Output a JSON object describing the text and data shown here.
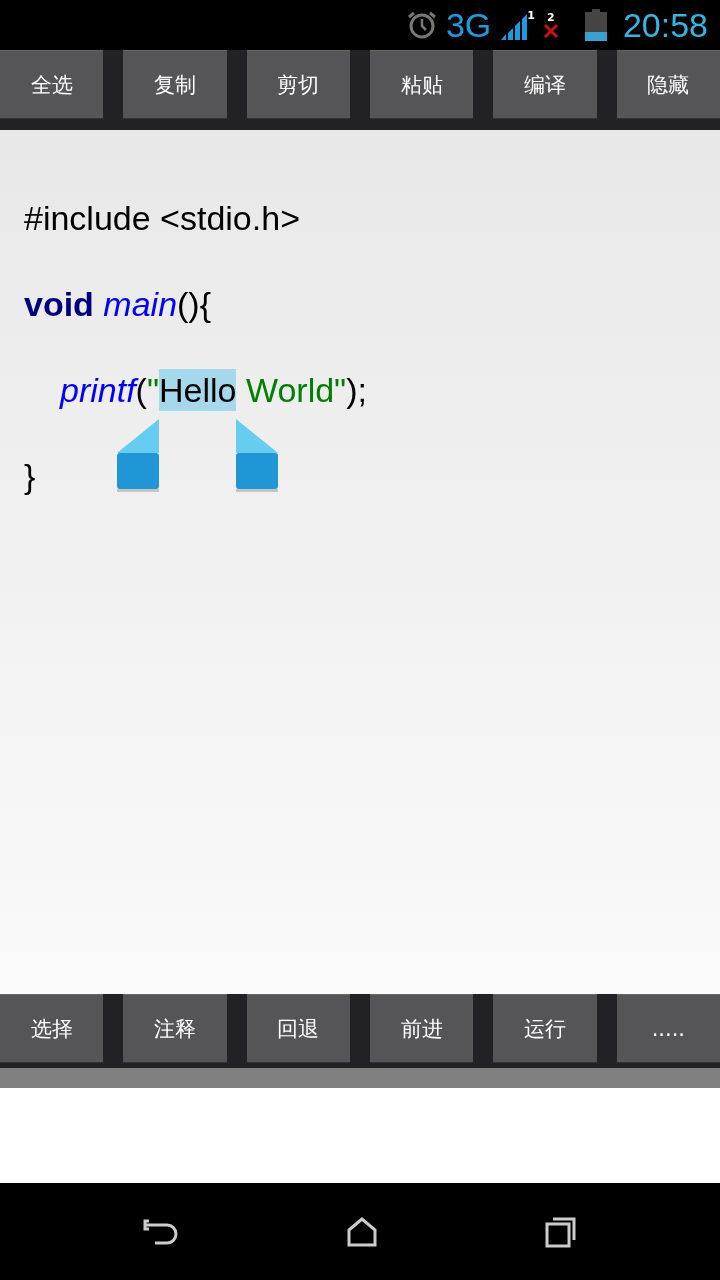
{
  "status_bar": {
    "network": "3G",
    "sim_1": "1",
    "sim_2": "2",
    "time": "20:58"
  },
  "top_toolbar": {
    "buttons": [
      "全选",
      "复制",
      "剪切",
      "粘贴",
      "编译",
      "隐藏"
    ]
  },
  "editor": {
    "lines": [
      {
        "indented": false,
        "tokens": [
          {
            "text": "#include <stdio.h>",
            "kind": "plain",
            "selected": false
          }
        ]
      },
      {
        "indented": false,
        "tokens": [
          {
            "text": "void",
            "kind": "keyword",
            "selected": false
          },
          {
            "text": " main",
            "kind": "function",
            "selected": false
          },
          {
            "text": "(){",
            "kind": "plain",
            "selected": false
          }
        ]
      },
      {
        "indented": true,
        "tokens": [
          {
            "text": "printf",
            "kind": "function",
            "selected": false
          },
          {
            "text": "(",
            "kind": "plain",
            "selected": false
          },
          {
            "text": "\"",
            "kind": "string",
            "selected": false
          },
          {
            "text": "Hello",
            "kind": "string",
            "selected": true
          },
          {
            "text": " World\"",
            "kind": "string",
            "selected": false
          },
          {
            "text": ");",
            "kind": "plain",
            "selected": false
          }
        ]
      },
      {
        "indented": false,
        "tokens": [
          {
            "text": "}",
            "kind": "plain",
            "selected": false
          }
        ]
      }
    ]
  },
  "bottom_toolbar": {
    "buttons": [
      "选择",
      "注释",
      "回退",
      "前进",
      "运行",
      "....."
    ]
  }
}
